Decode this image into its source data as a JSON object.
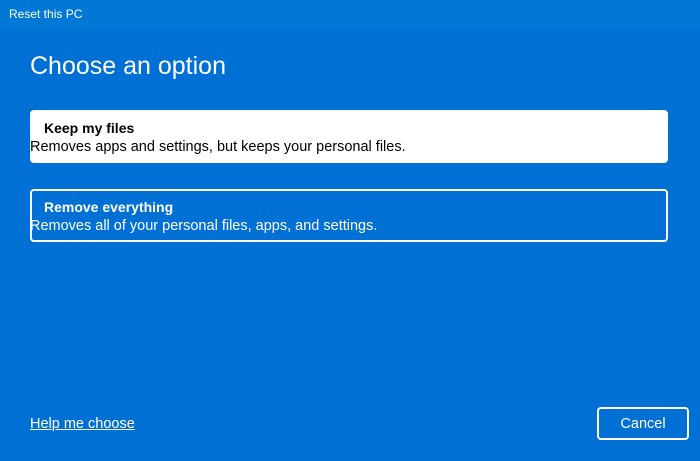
{
  "window": {
    "title": "Reset this PC"
  },
  "heading": "Choose an option",
  "options": [
    {
      "title": "Keep my files",
      "description": "Removes apps and settings, but keeps your personal files."
    },
    {
      "title": "Remove everything",
      "description": "Removes all of your personal files, apps, and settings."
    }
  ],
  "footer": {
    "help_link": "Help me choose",
    "cancel_label": "Cancel"
  }
}
